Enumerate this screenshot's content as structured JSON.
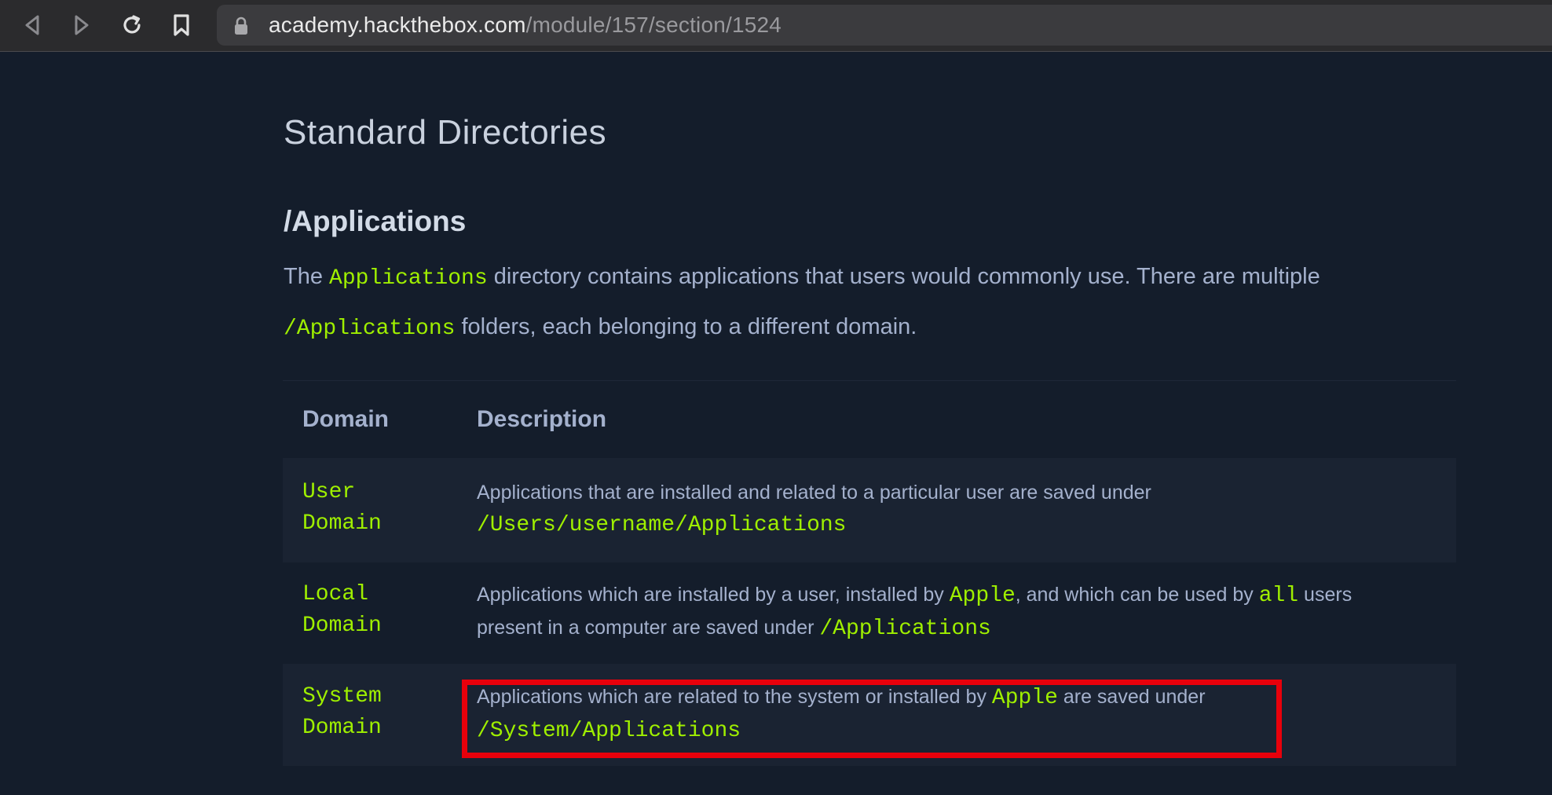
{
  "browser": {
    "url_host": "academy.hackthebox.com",
    "url_path": "/module/157/section/1524"
  },
  "page": {
    "title": "Standard Directories",
    "heading": "/Applications",
    "para1_before": "The ",
    "para1_code": "Applications",
    "para1_after": " directory contains applications that users would commonly use. There are multiple",
    "para2_code": "/Applications",
    "para2_after": " folders, each belonging to a different domain."
  },
  "table": {
    "headers": {
      "domain": "Domain",
      "description": "Description"
    },
    "rows": [
      {
        "domain_line1": "User",
        "domain_line2": "Domain",
        "desc_text": "Applications that are installed and related to a particular user are saved under",
        "desc_code": "/Users/username/Applications"
      },
      {
        "domain_line1": "Local",
        "domain_line2": "Domain",
        "desc_a": "Applications which are installed by a user, installed by ",
        "desc_code1": "Apple",
        "desc_b": ", and which can be used by ",
        "desc_code2": "all",
        "desc_c": " users",
        "desc_d": "present in a computer are saved under ",
        "desc_code3": "/Applications"
      },
      {
        "domain_line1": "System",
        "domain_line2": "Domain",
        "desc_a": "Applications which are related to the system or installed by ",
        "desc_code1": "Apple",
        "desc_b": " are saved under",
        "desc_code2": "/System/Applications"
      }
    ]
  },
  "colors": {
    "background": "#141d2b",
    "accent_green": "#9fef00",
    "highlight_red": "#e8000b"
  },
  "icons": [
    "back-icon",
    "forward-icon",
    "reload-icon",
    "bookmark-icon",
    "lock-icon"
  ]
}
